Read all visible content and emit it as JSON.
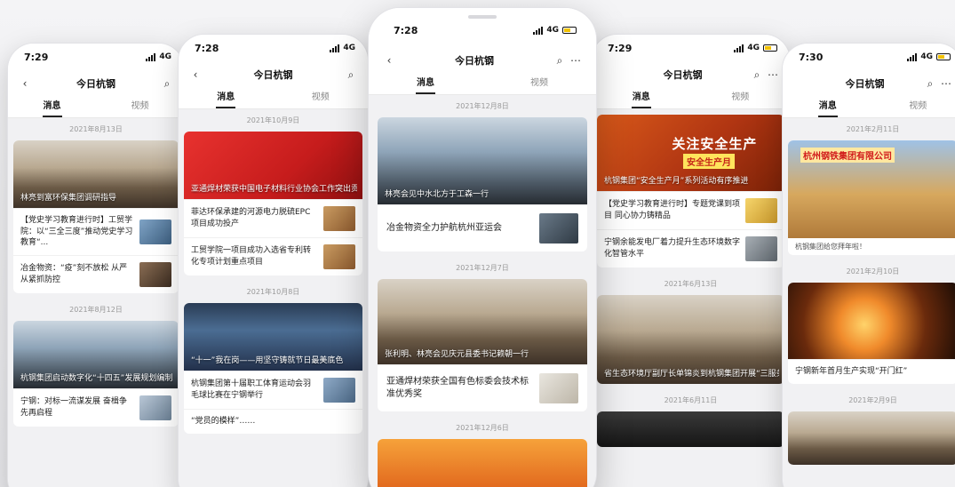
{
  "phones": {
    "p1": {
      "time": "7:29",
      "network": "4G",
      "title": "今日杭钢",
      "tabs": [
        "消息",
        "视频"
      ],
      "date1": "2021年8月13日",
      "hero1_caption": "林亮到富环保集团调研指导",
      "row1": "【党史学习教育进行时】工贸学院：以“三全三度”推动党史学习教育“...",
      "row2": "冶金物资：“疫”刻不放松 从严从紧抓防控",
      "date2": "2021年8月12日",
      "hero2_caption": "杭钢集团启动数字化“十四五”发展规划编制工作",
      "row3": "宁钢：对标一流谋发展 奋楫争先再启程"
    },
    "p2": {
      "time": "7:28",
      "network": "4G",
      "title": "今日杭钢",
      "tabs": [
        "消息",
        "视频"
      ],
      "date1": "2021年10月9日",
      "hero1_caption": "亚通焊材荣获中国电子材料行业协会工作突出贡献奖",
      "row1": "菲达环保承建的河源电力脱硫EPC项目成功投产",
      "row2": "工贸学院一项目成功入选省专利转化专项计划重点项目",
      "date2": "2021年10月8日",
      "hero2_caption": "“十一”我在岗——用坚守铸就节日最美底色",
      "row3": "杭钢集团第十届职工体育运动会羽毛球比赛在宁钢举行",
      "row4": "“党员的模样”……"
    },
    "p3": {
      "time": "7:28",
      "network": "4G",
      "title": "今日杭钢",
      "tabs": [
        "消息",
        "视频"
      ],
      "date1": "2021年12月8日",
      "hero1_caption": "林亮会见中水北方于工森一行",
      "row1": "冶金物资全力护航杭州亚运会",
      "date2": "2021年12月7日",
      "hero2_caption": "张利明、林亮会见庆元县委书记赖朝一行",
      "row2": "亚通焊材荣获全国有色标委会技术标准优秀奖",
      "date3": "2021年12月6日"
    },
    "p4": {
      "time": "7:29",
      "network": "4G",
      "title": "今日杭钢",
      "tabs": [
        "消息",
        "视频"
      ],
      "hero1_title": "关注安全生产",
      "hero1_sub": "安全生产月",
      "hero1_caption": "杭钢集团“安全生产月”系列活动有序推进",
      "row1": "【党史学习教育进行时】专题党课到项目 同心协力铸精品",
      "row2": "宁钢余能发电厂着力提升生态环境数字化智管水平",
      "date1": "2021年6月13日",
      "hero2_caption": "省生态环境厅副厅长单锦炎到杭钢集团开展“三服务”活动",
      "date2": "2021年6月11日"
    },
    "p5": {
      "time": "7:30",
      "network": "4G",
      "title": "今日杭钢",
      "tabs": [
        "消息",
        "视频"
      ],
      "date1": "2021年2月11日",
      "hero1_sign": "杭州钢铁集团有限公司",
      "hero1_caption": "杭钢集团给您拜年啦！",
      "date2": "2021年2月10日",
      "hero2_caption": "宁钢新年首月生产实现“开门红”",
      "date3": "2021年2月9日"
    }
  }
}
